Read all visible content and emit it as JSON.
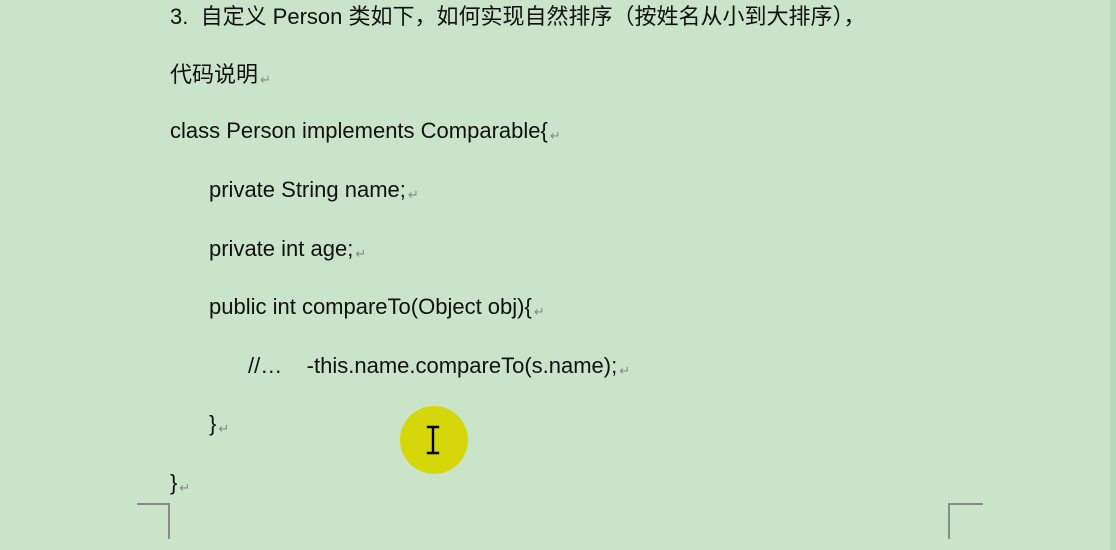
{
  "document": {
    "lines": [
      "3.  自定义 Person 类如下，如何实现自然排序（按姓名从小到大排序），",
      "代码说明",
      "class Person implements Comparable{",
      "private String name;",
      "private int age;",
      "public int compareTo(Object obj){",
      "//…    -this.name.compareTo(s.name);",
      "}",
      "}"
    ],
    "paragraph_mark": "↵"
  },
  "cursor": {
    "icon": "text-cursor-icon",
    "highlight_color": "#d6d600"
  }
}
